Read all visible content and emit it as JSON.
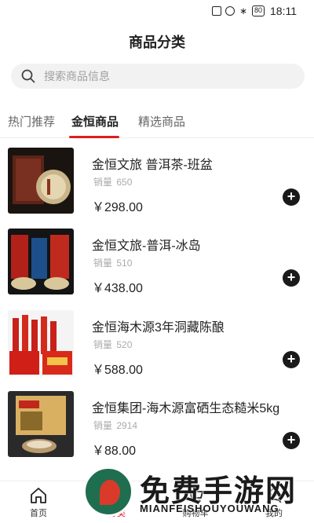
{
  "status_bar": {
    "battery": "80",
    "time": "18:11"
  },
  "header": {
    "title": "商品分类"
  },
  "search": {
    "placeholder": "搜索商品信息"
  },
  "tabs": [
    {
      "label": "热门推荐",
      "active": false
    },
    {
      "label": "金恒商品",
      "active": true
    },
    {
      "label": "精选商品",
      "active": false
    }
  ],
  "products": [
    {
      "name": "金恒文旅 普洱茶-班盆",
      "sales_label": "销量",
      "sales": "650",
      "price": "￥298.00"
    },
    {
      "name": "金恒文旅-普洱-冰岛",
      "sales_label": "销量",
      "sales": "510",
      "price": "￥438.00"
    },
    {
      "name": "金恒海木源3年洞藏陈酿",
      "sales_label": "销量",
      "sales": "520",
      "price": "￥588.00"
    },
    {
      "name": "金恒集团-海木源富硒生态糙米5kg",
      "sales_label": "销量",
      "sales": "2914",
      "price": "￥88.00"
    }
  ],
  "bottom_nav": [
    {
      "label": "首页"
    },
    {
      "label": "分类"
    },
    {
      "label": "购物车"
    },
    {
      "label": "我的"
    }
  ],
  "watermark": {
    "title": "免费手游网",
    "subtitle": "MIANFEISHOUYOUWANG"
  },
  "colors": {
    "accent": "#e21c1c",
    "add_button": "#1a1a1a"
  }
}
